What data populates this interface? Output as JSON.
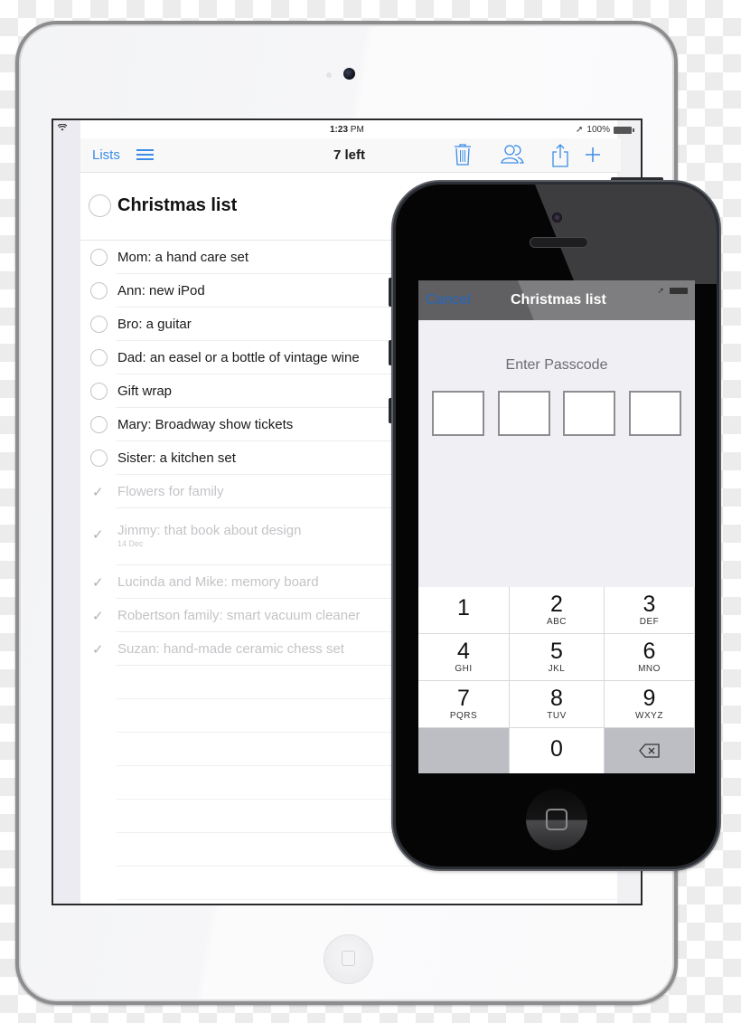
{
  "ipad": {
    "status_bar": {
      "time_bold": "1:23",
      "time_suffix": " PM",
      "battery_label": "100%",
      "wifi_icon": "wifi-icon",
      "location_icon": "location-arrow-icon"
    },
    "nav": {
      "lists_label": "Lists",
      "menu_icon": "hamburger-menu-icon",
      "title": "7 left",
      "trash_icon": "trash-icon",
      "share_people_icon": "people-icon",
      "share_icon": "share-icon",
      "add_icon": "plus-icon"
    },
    "list_title": "Christmas list",
    "items": [
      {
        "text": "Mom: a hand care set",
        "done": false
      },
      {
        "text": "Ann: new iPod",
        "done": false
      },
      {
        "text": "Bro: a guitar",
        "done": false
      },
      {
        "text": "Dad: an easel or a bottle of vintage wine",
        "done": false
      },
      {
        "text": "Gift wrap",
        "done": false
      },
      {
        "text": "Mary: Broadway show tickets",
        "done": false
      },
      {
        "text": "Sister: a kitchen set",
        "done": false
      },
      {
        "text": "Flowers for family",
        "done": true
      },
      {
        "text": "Jimmy: that book about design",
        "done": true,
        "date": "14 Dec"
      },
      {
        "text": "Lucinda and Mike: memory board",
        "done": true
      },
      {
        "text": "Robertson family: smart vacuum cleaner",
        "done": true
      },
      {
        "text": "Suzan: hand-made ceramic chess set",
        "done": true
      }
    ],
    "accent_color": "#3b8ce6"
  },
  "iphone": {
    "nav": {
      "cancel_label": "Cancel",
      "title": "Christmas list"
    },
    "passcode_label": "Enter Passcode",
    "passcode_boxes": [
      "",
      "",
      "",
      ""
    ],
    "keypad": [
      {
        "num": "1",
        "letters": ""
      },
      {
        "num": "2",
        "letters": "ABC"
      },
      {
        "num": "3",
        "letters": "DEF"
      },
      {
        "num": "4",
        "letters": "GHI"
      },
      {
        "num": "5",
        "letters": "JKL"
      },
      {
        "num": "6",
        "letters": "MNO"
      },
      {
        "num": "7",
        "letters": "PQRS"
      },
      {
        "num": "8",
        "letters": "TUV"
      },
      {
        "num": "9",
        "letters": "WXYZ"
      },
      {
        "num": "",
        "letters": ""
      },
      {
        "num": "0",
        "letters": ""
      },
      {
        "num": "⌫",
        "letters": ""
      }
    ],
    "delete_icon": "backspace-icon"
  }
}
